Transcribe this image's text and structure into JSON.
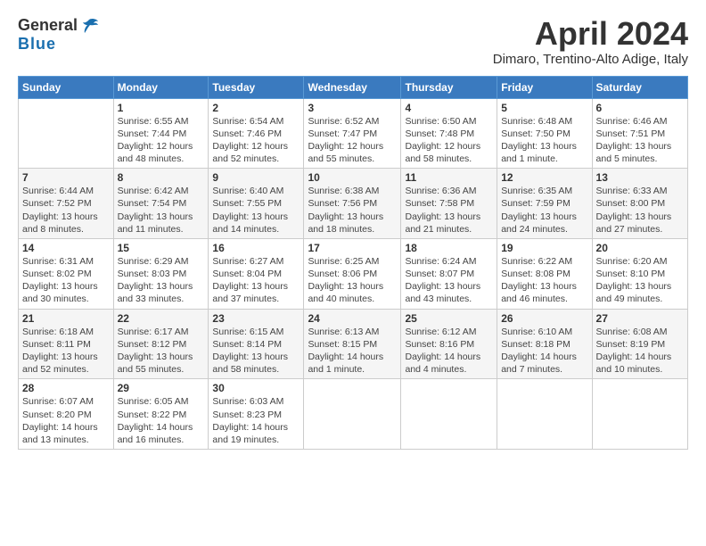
{
  "logo": {
    "line1": "General",
    "line2": "Blue",
    "bird_unicode": "🐦"
  },
  "title": "April 2024",
  "location": "Dimaro, Trentino-Alto Adige, Italy",
  "header_days": [
    "Sunday",
    "Monday",
    "Tuesday",
    "Wednesday",
    "Thursday",
    "Friday",
    "Saturday"
  ],
  "weeks": [
    [
      {
        "num": "",
        "detail": ""
      },
      {
        "num": "1",
        "detail": "Sunrise: 6:55 AM\nSunset: 7:44 PM\nDaylight: 12 hours\nand 48 minutes."
      },
      {
        "num": "2",
        "detail": "Sunrise: 6:54 AM\nSunset: 7:46 PM\nDaylight: 12 hours\nand 52 minutes."
      },
      {
        "num": "3",
        "detail": "Sunrise: 6:52 AM\nSunset: 7:47 PM\nDaylight: 12 hours\nand 55 minutes."
      },
      {
        "num": "4",
        "detail": "Sunrise: 6:50 AM\nSunset: 7:48 PM\nDaylight: 12 hours\nand 58 minutes."
      },
      {
        "num": "5",
        "detail": "Sunrise: 6:48 AM\nSunset: 7:50 PM\nDaylight: 13 hours\nand 1 minute."
      },
      {
        "num": "6",
        "detail": "Sunrise: 6:46 AM\nSunset: 7:51 PM\nDaylight: 13 hours\nand 5 minutes."
      }
    ],
    [
      {
        "num": "7",
        "detail": "Sunrise: 6:44 AM\nSunset: 7:52 PM\nDaylight: 13 hours\nand 8 minutes."
      },
      {
        "num": "8",
        "detail": "Sunrise: 6:42 AM\nSunset: 7:54 PM\nDaylight: 13 hours\nand 11 minutes."
      },
      {
        "num": "9",
        "detail": "Sunrise: 6:40 AM\nSunset: 7:55 PM\nDaylight: 13 hours\nand 14 minutes."
      },
      {
        "num": "10",
        "detail": "Sunrise: 6:38 AM\nSunset: 7:56 PM\nDaylight: 13 hours\nand 18 minutes."
      },
      {
        "num": "11",
        "detail": "Sunrise: 6:36 AM\nSunset: 7:58 PM\nDaylight: 13 hours\nand 21 minutes."
      },
      {
        "num": "12",
        "detail": "Sunrise: 6:35 AM\nSunset: 7:59 PM\nDaylight: 13 hours\nand 24 minutes."
      },
      {
        "num": "13",
        "detail": "Sunrise: 6:33 AM\nSunset: 8:00 PM\nDaylight: 13 hours\nand 27 minutes."
      }
    ],
    [
      {
        "num": "14",
        "detail": "Sunrise: 6:31 AM\nSunset: 8:02 PM\nDaylight: 13 hours\nand 30 minutes."
      },
      {
        "num": "15",
        "detail": "Sunrise: 6:29 AM\nSunset: 8:03 PM\nDaylight: 13 hours\nand 33 minutes."
      },
      {
        "num": "16",
        "detail": "Sunrise: 6:27 AM\nSunset: 8:04 PM\nDaylight: 13 hours\nand 37 minutes."
      },
      {
        "num": "17",
        "detail": "Sunrise: 6:25 AM\nSunset: 8:06 PM\nDaylight: 13 hours\nand 40 minutes."
      },
      {
        "num": "18",
        "detail": "Sunrise: 6:24 AM\nSunset: 8:07 PM\nDaylight: 13 hours\nand 43 minutes."
      },
      {
        "num": "19",
        "detail": "Sunrise: 6:22 AM\nSunset: 8:08 PM\nDaylight: 13 hours\nand 46 minutes."
      },
      {
        "num": "20",
        "detail": "Sunrise: 6:20 AM\nSunset: 8:10 PM\nDaylight: 13 hours\nand 49 minutes."
      }
    ],
    [
      {
        "num": "21",
        "detail": "Sunrise: 6:18 AM\nSunset: 8:11 PM\nDaylight: 13 hours\nand 52 minutes."
      },
      {
        "num": "22",
        "detail": "Sunrise: 6:17 AM\nSunset: 8:12 PM\nDaylight: 13 hours\nand 55 minutes."
      },
      {
        "num": "23",
        "detail": "Sunrise: 6:15 AM\nSunset: 8:14 PM\nDaylight: 13 hours\nand 58 minutes."
      },
      {
        "num": "24",
        "detail": "Sunrise: 6:13 AM\nSunset: 8:15 PM\nDaylight: 14 hours\nand 1 minute."
      },
      {
        "num": "25",
        "detail": "Sunrise: 6:12 AM\nSunset: 8:16 PM\nDaylight: 14 hours\nand 4 minutes."
      },
      {
        "num": "26",
        "detail": "Sunrise: 6:10 AM\nSunset: 8:18 PM\nDaylight: 14 hours\nand 7 minutes."
      },
      {
        "num": "27",
        "detail": "Sunrise: 6:08 AM\nSunset: 8:19 PM\nDaylight: 14 hours\nand 10 minutes."
      }
    ],
    [
      {
        "num": "28",
        "detail": "Sunrise: 6:07 AM\nSunset: 8:20 PM\nDaylight: 14 hours\nand 13 minutes."
      },
      {
        "num": "29",
        "detail": "Sunrise: 6:05 AM\nSunset: 8:22 PM\nDaylight: 14 hours\nand 16 minutes."
      },
      {
        "num": "30",
        "detail": "Sunrise: 6:03 AM\nSunset: 8:23 PM\nDaylight: 14 hours\nand 19 minutes."
      },
      {
        "num": "",
        "detail": ""
      },
      {
        "num": "",
        "detail": ""
      },
      {
        "num": "",
        "detail": ""
      },
      {
        "num": "",
        "detail": ""
      }
    ]
  ]
}
